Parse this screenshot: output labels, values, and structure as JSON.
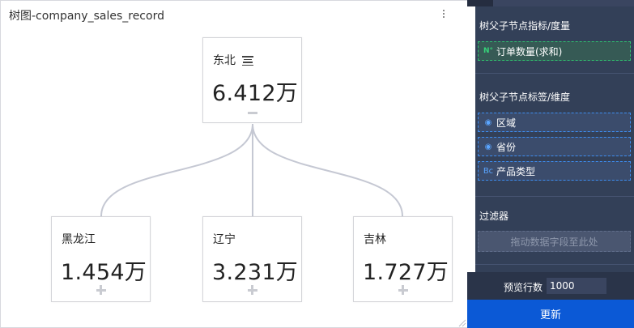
{
  "chart_panel": {
    "title": "树图-company_sales_record",
    "root": {
      "label": "东北",
      "value": "6.412万"
    },
    "children": [
      {
        "label": "黑龙江",
        "value": "1.454万"
      },
      {
        "label": "辽宁",
        "value": "3.231万"
      },
      {
        "label": "吉林",
        "value": "1.727万"
      }
    ]
  },
  "config": {
    "measure_section": {
      "title": "树父子节点指标/度量",
      "fields": [
        {
          "icon": "N°",
          "label": "订单数量(求和)"
        }
      ]
    },
    "dimension_section": {
      "title": "树父子节点标签/维度",
      "fields": [
        {
          "icon": "◉",
          "label": "区域"
        },
        {
          "icon": "◉",
          "label": "省份"
        },
        {
          "icon": "Bc",
          "label": "产品类型"
        }
      ]
    },
    "filter_section": {
      "title": "过滤器",
      "drop_hint": "拖动数据字段至此处"
    },
    "preview": {
      "label": "预览行数",
      "value": "1000"
    },
    "update_button": "更新"
  },
  "colors": {
    "panel_bg": "#2f3a52",
    "accent_blue": "#0b59d6",
    "measure_green": "#2fc36f",
    "dimension_blue": "#3d8df0",
    "link_color": "#c5c8d3"
  }
}
